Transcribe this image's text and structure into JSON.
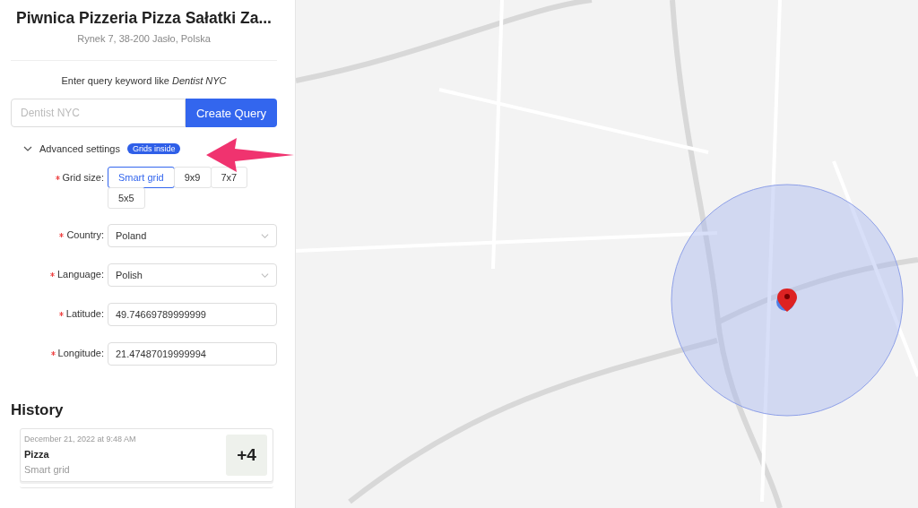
{
  "place": {
    "name": "Piwnica Pizzeria Pizza Sałatki Za...",
    "address": "Rynek 7, 38-200 Jasło, Polska"
  },
  "query": {
    "hint": "Enter query keyword like *Dentist NYC*",
    "placeholder": "Dentist NYC",
    "button": "Create Query"
  },
  "advanced": {
    "label": "Advanced settings",
    "expanded": true,
    "badge": "Grids inside"
  },
  "grid_size": {
    "label": "Grid size:",
    "required": true,
    "options": [
      {
        "label": "Smart grid",
        "selected": true
      },
      {
        "label": "9x9",
        "selected": false
      },
      {
        "label": "7x7",
        "selected": false
      },
      {
        "label": "5x5",
        "selected": false
      }
    ]
  },
  "fields": [
    {
      "kind": "select",
      "label": "Country:",
      "required": true,
      "value": "Poland"
    },
    {
      "kind": "select",
      "label": "Language:",
      "required": true,
      "value": "Polish"
    },
    {
      "kind": "text",
      "label": "Latitude:",
      "required": true,
      "value": "49.74669789999999"
    },
    {
      "kind": "text",
      "label": "Longitude:",
      "required": true,
      "value": "21.47487019999994"
    }
  ],
  "history": {
    "title": "History",
    "items": [
      {
        "date": "December 21, 2022 at 9:48 AM",
        "keyword": "Pizza",
        "grid": "Smart grid",
        "count": "+4"
      }
    ]
  }
}
